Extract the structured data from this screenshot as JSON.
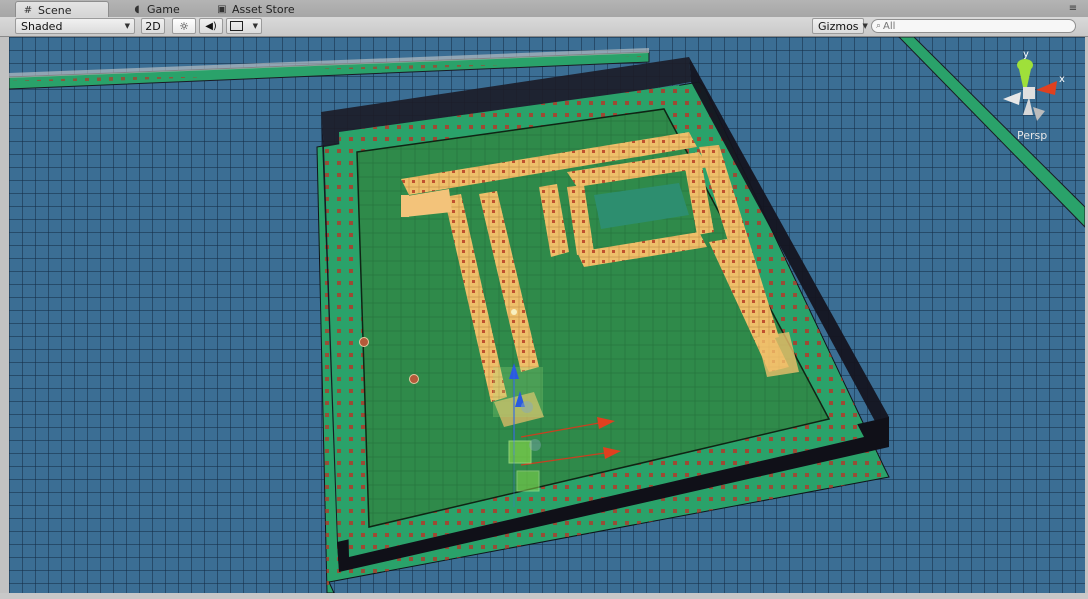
{
  "tabs": [
    {
      "label": "Scene",
      "icon": "grid-icon",
      "active": true
    },
    {
      "label": "Game",
      "icon": "pacman-icon",
      "active": false
    },
    {
      "label": "Asset Store",
      "icon": "store-bag-icon",
      "active": false
    }
  ],
  "toolbar": {
    "shading_mode": "Shaded",
    "mode_2d_label": "2D",
    "gizmos_label": "Gizmos",
    "search_placeholder": "All"
  },
  "gizmo": {
    "y_label": "y",
    "x_label": "x",
    "projection_label": "Persp"
  },
  "colors": {
    "sky_grid": "#3b6e94",
    "floor": "#2f8a4a",
    "border_strip": "#2aa26a",
    "wall_dark": "#15151f",
    "maze_wall": "#f0c070",
    "dot": "#b03a2a",
    "axis_x": "#e0401f",
    "axis_y": "#9fe03a",
    "axis_z": "#3a6ee0"
  }
}
